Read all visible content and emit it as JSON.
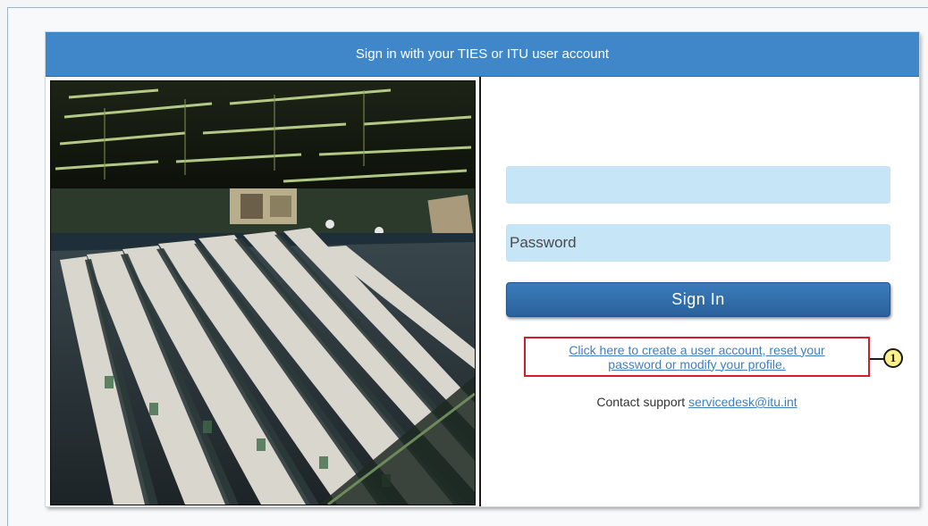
{
  "login": {
    "header_title": "Sign in with your TIES or ITU user account",
    "username": {
      "value": "",
      "placeholder": ""
    },
    "password": {
      "value": "",
      "placeholder": "Password"
    },
    "signin_label": "Sign In",
    "account_link_line1": "Click here to create a user account, reset your",
    "account_link_line2": "password or modify your profile.",
    "contact_prefix": "Contact support",
    "support_email": "servicedesk@itu.int"
  },
  "annotation": {
    "callout_number": "1",
    "highlight_color": "#d21e2a",
    "marker_color": "#fdf08a"
  },
  "colors": {
    "header": "#3f87c9",
    "button": "#2f6ca8",
    "field": "#c6e5f6",
    "link": "#3f7fbf"
  },
  "photo": {
    "subject": "conference-hall-photo"
  }
}
